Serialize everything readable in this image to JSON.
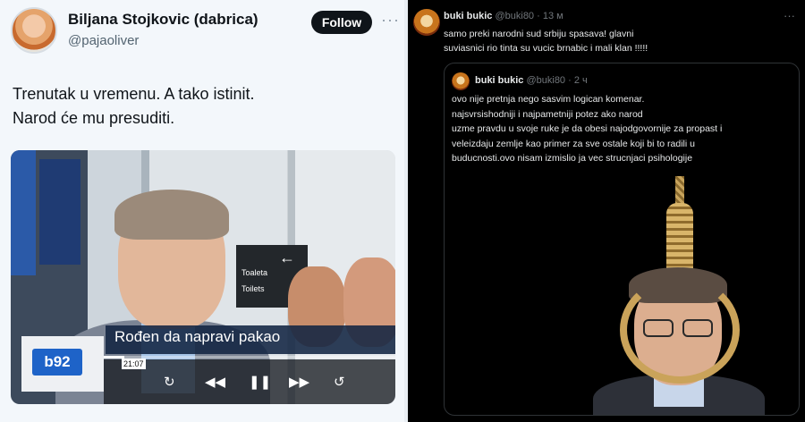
{
  "left_post": {
    "author_name": "Biljana Stojkovic (dabrica)",
    "author_handle": "@pajaoliver",
    "follow_label": "Follow",
    "more_label": "···",
    "text_line1": "Trenutak u vremenu. A tako istinit.",
    "text_line2": "Narod će mu presuditi.",
    "video": {
      "caption": "Rođen da napravi pakao",
      "channel_logo": "b92",
      "time_badge": "21:07",
      "progress": 0.07,
      "controls": [
        "replay-icon",
        "rewind-icon",
        "pause-icon",
        "fast-forward-icon",
        "refresh-icon"
      ],
      "sign_text_1": "Toaleta",
      "sign_text_2": "Toilets"
    }
  },
  "right_post": {
    "author_name": "buki bukic",
    "author_handle": "@buki80",
    "time": "· 13 м",
    "more_label": "···",
    "text_line1": "samo preki narodni sud srbiju spasava! glavni",
    "text_line2": "suviasnici rio tinta su vucic brnabic i mali klan !!!!!",
    "quoted": {
      "author_name": "buki bukic",
      "author_handle": "@buki80",
      "time": "· 2 ч",
      "lines": [
        "ovo nije pretnja nego sasvim logican komenar.",
        "najsvrsishodniji i najpametniji potez ako narod",
        "uzme pravdu u svoje ruke je da obesi najodgovornije za propast i",
        "veleizdaju zemlje kao primer za sve ostale koji bi to radili u",
        "buducnosti.ovo nisam izmislio ja vec strucnjaci psihologije"
      ]
    }
  }
}
